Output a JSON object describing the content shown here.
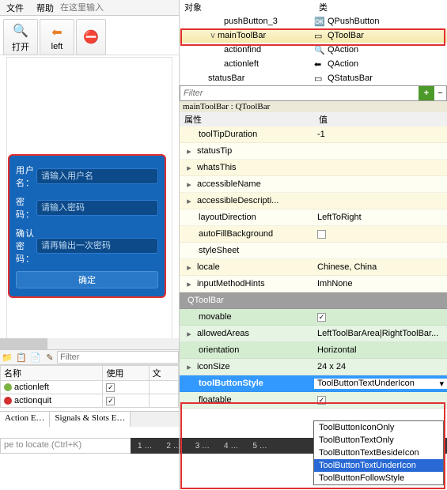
{
  "menubar": {
    "file": "文件",
    "help": "帮助",
    "input_ph": "在这里输入"
  },
  "toolbar": {
    "open": {
      "label": "打开"
    },
    "left": {
      "label": "left"
    }
  },
  "form": {
    "user_label": "用户名：",
    "user_ph": "请输入用户名",
    "pwd_label": "密    码：",
    "pwd_ph": "请输入密码",
    "confirm_label": "确认密码：",
    "confirm_ph": "请再输出一次密码",
    "btn": "确定"
  },
  "mini_toolbar": {
    "filter_ph": "Filter"
  },
  "action_table": {
    "h1": "名称",
    "h2": "使用",
    "h3": "文",
    "rows": [
      {
        "name": "actionleft",
        "checked": true
      },
      {
        "name": "actionquit",
        "checked": true
      }
    ]
  },
  "bottom_tabs": {
    "t1": "Action E…",
    "t2": "Signals & Slots E…"
  },
  "locator": {
    "text": "pe to locate (Ctrl+K)"
  },
  "numbar": {
    "items": [
      "1  …",
      "2 …",
      "3  …",
      "4  …",
      "5  …"
    ]
  },
  "obj_header": {
    "c1": "对象",
    "c2": "类"
  },
  "tree": [
    {
      "name": "pushButton_3",
      "cls": "QPushButton",
      "indent": 50,
      "icon": "ok"
    },
    {
      "name": "mainToolBar",
      "cls": "QToolBar",
      "indent": 30,
      "exp": "v",
      "sel": true,
      "icon": "bar"
    },
    {
      "name": "actionfind",
      "cls": "QAction",
      "indent": 50,
      "icon": "find"
    },
    {
      "name": "actionleft",
      "cls": "QAction",
      "indent": 50,
      "icon": "left"
    },
    {
      "name": "statusBar",
      "cls": "QStatusBar",
      "indent": 30,
      "icon": "bar"
    }
  ],
  "filter": {
    "ph": "Filter"
  },
  "breadcrumb": "mainToolBar : QToolBar",
  "prop_header": {
    "c1": "属性",
    "c2": "值"
  },
  "props": [
    {
      "name": "toolTipDuration",
      "val": "-1",
      "cls": "yellow",
      "indent": 18
    },
    {
      "name": "statusTip",
      "val": "",
      "cls": "yellow-odd",
      "exp": true
    },
    {
      "name": "whatsThis",
      "val": "",
      "cls": "yellow",
      "exp": true
    },
    {
      "name": "accessibleName",
      "val": "",
      "cls": "yellow-odd",
      "exp": true
    },
    {
      "name": "accessibleDescripti...",
      "val": "",
      "cls": "yellow",
      "exp": true
    },
    {
      "name": "layoutDirection",
      "val": "LeftToRight",
      "cls": "yellow-odd",
      "indent": 18
    },
    {
      "name": "autoFillBackground",
      "val": "",
      "cls": "yellow",
      "indent": 18,
      "chk": false
    },
    {
      "name": "styleSheet",
      "val": "",
      "cls": "yellow-odd",
      "indent": 18
    },
    {
      "name": "locale",
      "val": "Chinese, China",
      "cls": "yellow",
      "exp": true
    },
    {
      "name": "inputMethodHints",
      "val": "ImhNone",
      "cls": "yellow-odd",
      "exp": true
    },
    {
      "name": "QToolBar",
      "val": "",
      "cls": "grey-section",
      "indent": 4
    },
    {
      "name": "movable",
      "val": "",
      "cls": "green",
      "indent": 18,
      "chk": true
    },
    {
      "name": "allowedAreas",
      "val": "LeftToolBarArea|RightToolBar...",
      "cls": "green-odd",
      "exp": true
    },
    {
      "name": "orientation",
      "val": "Horizontal",
      "cls": "green",
      "indent": 18
    },
    {
      "name": "iconSize",
      "val": "24 x 24",
      "cls": "green-odd",
      "exp": true
    },
    {
      "name": "toolButtonStyle",
      "val": "ToolButtonTextUnderIcon",
      "cls": "green",
      "indent": 18,
      "selected": true,
      "combo": true
    },
    {
      "name": "floatable",
      "val": "",
      "cls": "green-odd",
      "indent": 18,
      "chk": true
    }
  ],
  "dropdown": {
    "items": [
      "ToolButtonIconOnly",
      "ToolButtonTextOnly",
      "ToolButtonTextBesideIcon",
      "ToolButtonTextUnderIcon",
      "ToolButtonFollowStyle"
    ],
    "selected": 3
  }
}
